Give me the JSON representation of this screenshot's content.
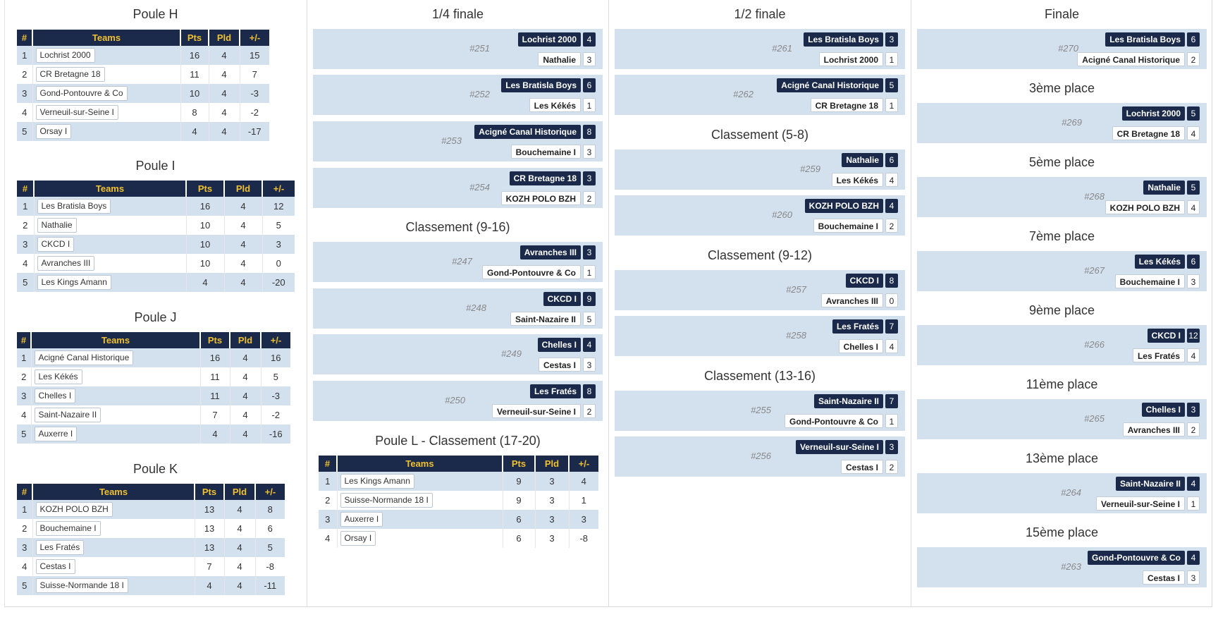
{
  "headers": {
    "rank": "#",
    "team": "Teams",
    "pts": "Pts",
    "pld": "Pld",
    "diff": "+/-"
  },
  "pools": [
    {
      "title": "Poule H",
      "rows": [
        {
          "rank": "1",
          "team": "Lochrist 2000",
          "pts": "16",
          "pld": "4",
          "diff": "15"
        },
        {
          "rank": "2",
          "team": "CR Bretagne 18",
          "pts": "11",
          "pld": "4",
          "diff": "7"
        },
        {
          "rank": "3",
          "team": "Gond-Pontouvre & Co",
          "pts": "10",
          "pld": "4",
          "diff": "-3"
        },
        {
          "rank": "4",
          "team": "Verneuil-sur-Seine I",
          "pts": "8",
          "pld": "4",
          "diff": "-2"
        },
        {
          "rank": "5",
          "team": "Orsay I",
          "pts": "4",
          "pld": "4",
          "diff": "-17"
        }
      ]
    },
    {
      "title": "Poule I",
      "rows": [
        {
          "rank": "1",
          "team": "Les Bratisla Boys",
          "pts": "16",
          "pld": "4",
          "diff": "12"
        },
        {
          "rank": "2",
          "team": "Nathalie",
          "pts": "10",
          "pld": "4",
          "diff": "5"
        },
        {
          "rank": "3",
          "team": "CKCD I",
          "pts": "10",
          "pld": "4",
          "diff": "3"
        },
        {
          "rank": "4",
          "team": "Avranches III",
          "pts": "10",
          "pld": "4",
          "diff": "0"
        },
        {
          "rank": "5",
          "team": "Les Kings Amann",
          "pts": "4",
          "pld": "4",
          "diff": "-20"
        }
      ]
    },
    {
      "title": "Poule J",
      "rows": [
        {
          "rank": "1",
          "team": "Acigné Canal Historique",
          "pts": "16",
          "pld": "4",
          "diff": "16"
        },
        {
          "rank": "2",
          "team": "Les Kékés",
          "pts": "11",
          "pld": "4",
          "diff": "5"
        },
        {
          "rank": "3",
          "team": "Chelles I",
          "pts": "11",
          "pld": "4",
          "diff": "-3"
        },
        {
          "rank": "4",
          "team": "Saint-Nazaire II",
          "pts": "7",
          "pld": "4",
          "diff": "-2"
        },
        {
          "rank": "5",
          "team": "Auxerre I",
          "pts": "4",
          "pld": "4",
          "diff": "-16"
        }
      ]
    },
    {
      "title": "Poule K",
      "rows": [
        {
          "rank": "1",
          "team": "KOZH POLO BZH",
          "pts": "13",
          "pld": "4",
          "diff": "8"
        },
        {
          "rank": "2",
          "team": "Bouchemaine I",
          "pts": "13",
          "pld": "4",
          "diff": "6"
        },
        {
          "rank": "3",
          "team": "Les Fratés",
          "pts": "13",
          "pld": "4",
          "diff": "5"
        },
        {
          "rank": "4",
          "team": "Cestas I",
          "pts": "7",
          "pld": "4",
          "diff": "-8"
        },
        {
          "rank": "5",
          "team": "Suisse-Normande 18 I",
          "pts": "4",
          "pld": "4",
          "diff": "-11"
        }
      ]
    },
    {
      "title": "Poule L - Classement (17-20)",
      "rows": [
        {
          "rank": "1",
          "team": "Les Kings Amann",
          "pts": "9",
          "pld": "3",
          "diff": "4"
        },
        {
          "rank": "2",
          "team": "Suisse-Normande 18 I",
          "pts": "9",
          "pld": "3",
          "diff": "1"
        },
        {
          "rank": "3",
          "team": "Auxerre I",
          "pts": "6",
          "pld": "3",
          "diff": "3"
        },
        {
          "rank": "4",
          "team": "Orsay I",
          "pts": "6",
          "pld": "3",
          "diff": "-8"
        }
      ]
    }
  ],
  "sections": [
    {
      "title": "1/4 finale",
      "matches": [
        {
          "id": "#251",
          "t1": "Lochrist 2000",
          "s1": "4",
          "t2": "Nathalie",
          "s2": "3"
        },
        {
          "id": "#252",
          "t1": "Les Bratisla Boys",
          "s1": "6",
          "t2": "Les Kékés",
          "s2": "1"
        },
        {
          "id": "#253",
          "t1": "Acigné Canal Historique",
          "s1": "8",
          "t2": "Bouchemaine I",
          "s2": "3"
        },
        {
          "id": "#254",
          "t1": "CR Bretagne 18",
          "s1": "3",
          "t2": "KOZH POLO BZH",
          "s2": "2"
        }
      ]
    },
    {
      "title": "Classement (9-16)",
      "matches": [
        {
          "id": "#247",
          "t1": "Avranches III",
          "s1": "3",
          "t2": "Gond-Pontouvre & Co",
          "s2": "1"
        },
        {
          "id": "#248",
          "t1": "CKCD I",
          "s1": "9",
          "t2": "Saint-Nazaire II",
          "s2": "5"
        },
        {
          "id": "#249",
          "t1": "Chelles I",
          "s1": "4",
          "t2": "Cestas I",
          "s2": "3"
        },
        {
          "id": "#250",
          "t1": "Les Fratés",
          "s1": "8",
          "t2": "Verneuil-sur-Seine I",
          "s2": "2"
        }
      ]
    },
    {
      "title": "1/2 finale",
      "matches": [
        {
          "id": "#261",
          "t1": "Les Bratisla Boys",
          "s1": "3",
          "t2": "Lochrist 2000",
          "s2": "1"
        },
        {
          "id": "#262",
          "t1": "Acigné Canal Historique",
          "s1": "5",
          "t2": "CR Bretagne 18",
          "s2": "1"
        }
      ]
    },
    {
      "title": "Classement (5-8)",
      "matches": [
        {
          "id": "#259",
          "t1": "Nathalie",
          "s1": "6",
          "t2": "Les Kékés",
          "s2": "4"
        },
        {
          "id": "#260",
          "t1": "KOZH POLO BZH",
          "s1": "4",
          "t2": "Bouchemaine I",
          "s2": "2"
        }
      ]
    },
    {
      "title": "Classement (9-12)",
      "matches": [
        {
          "id": "#257",
          "t1": "CKCD I",
          "s1": "8",
          "t2": "Avranches III",
          "s2": "0"
        },
        {
          "id": "#258",
          "t1": "Les Fratés",
          "s1": "7",
          "t2": "Chelles I",
          "s2": "4"
        }
      ]
    },
    {
      "title": "Classement (13-16)",
      "matches": [
        {
          "id": "#255",
          "t1": "Saint-Nazaire II",
          "s1": "7",
          "t2": "Gond-Pontouvre & Co",
          "s2": "1"
        },
        {
          "id": "#256",
          "t1": "Verneuil-sur-Seine I",
          "s1": "3",
          "t2": "Cestas I",
          "s2": "2"
        }
      ]
    },
    {
      "title": "Finale",
      "matches": [
        {
          "id": "#270",
          "t1": "Les Bratisla Boys",
          "s1": "6",
          "t2": "Acigné Canal Historique",
          "s2": "2"
        }
      ]
    },
    {
      "title": "3ème place",
      "matches": [
        {
          "id": "#269",
          "t1": "Lochrist 2000",
          "s1": "5",
          "t2": "CR Bretagne 18",
          "s2": "4"
        }
      ]
    },
    {
      "title": "5ème place",
      "matches": [
        {
          "id": "#268",
          "t1": "Nathalie",
          "s1": "5",
          "t2": "KOZH POLO BZH",
          "s2": "4"
        }
      ]
    },
    {
      "title": "7ème place",
      "matches": [
        {
          "id": "#267",
          "t1": "Les Kékés",
          "s1": "6",
          "t2": "Bouchemaine I",
          "s2": "3"
        }
      ]
    },
    {
      "title": "9ème place",
      "matches": [
        {
          "id": "#266",
          "t1": "CKCD I",
          "s1": "12",
          "t2": "Les Fratés",
          "s2": "4"
        }
      ]
    },
    {
      "title": "11ème place",
      "matches": [
        {
          "id": "#265",
          "t1": "Chelles I",
          "s1": "3",
          "t2": "Avranches III",
          "s2": "2"
        }
      ]
    },
    {
      "title": "13ème place",
      "matches": [
        {
          "id": "#264",
          "t1": "Saint-Nazaire II",
          "s1": "4",
          "t2": "Verneuil-sur-Seine I",
          "s2": "1"
        }
      ]
    },
    {
      "title": "15ème place",
      "matches": [
        {
          "id": "#263",
          "t1": "Gond-Pontouvre & Co",
          "s1": "4",
          "t2": "Cestas I",
          "s2": "3"
        }
      ]
    }
  ]
}
